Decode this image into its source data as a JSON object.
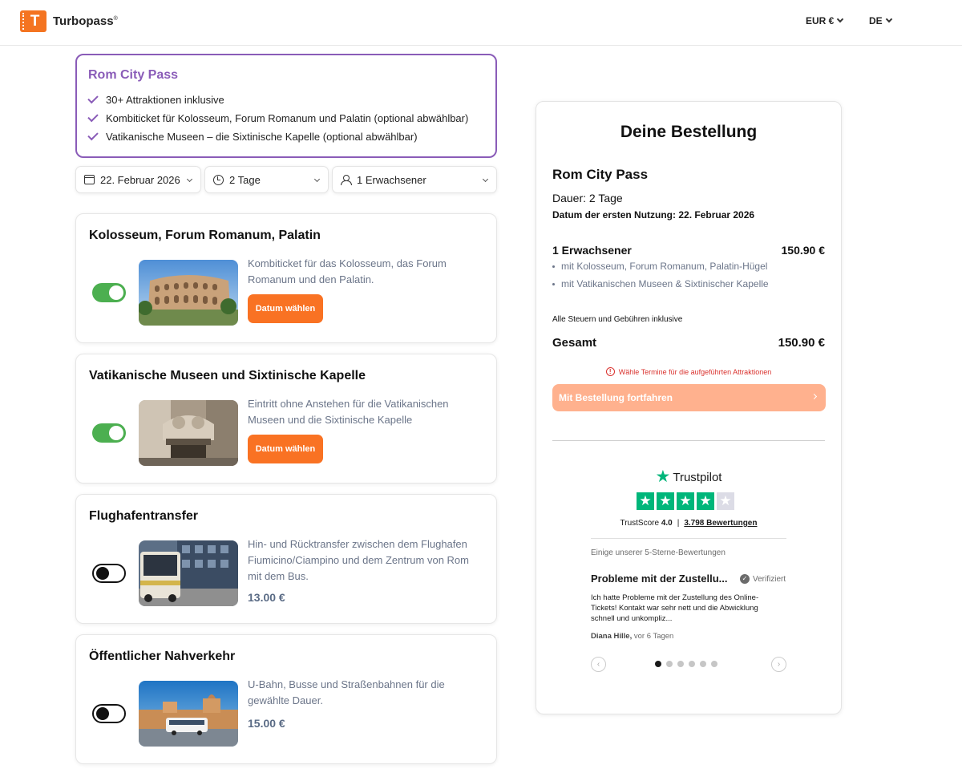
{
  "header": {
    "logo_letter": "T",
    "logo_text": "Turbopass",
    "logo_reg": "®",
    "currency": "EUR €",
    "language": "DE"
  },
  "pass": {
    "title": "Rom City Pass",
    "features": [
      "30+ Attraktionen inklusive",
      "Kombiticket für Kolosseum, Forum Romanum und Palatin (optional abwählbar)",
      "Vatikanische Museen – die Sixtinische Kapelle (optional abwählbar)"
    ]
  },
  "selectors": {
    "date": "22. Februar 2026",
    "duration": "2 Tage",
    "travelers": "1 Erwachsener"
  },
  "attractions": [
    {
      "title": "Kolosseum, Forum Romanum, Palatin",
      "description": "Kombiticket für das Kolosseum, das Forum Romanum und den Palatin.",
      "enabled": true,
      "button": "Datum wählen",
      "price": ""
    },
    {
      "title": "Vatikanische Museen und Sixtinische Kapelle",
      "description": "Eintritt ohne Anstehen für die Vatikanischen Museen und die Sixtinische Kapelle",
      "enabled": true,
      "button": "Datum wählen",
      "price": ""
    },
    {
      "title": "Flughafentransfer",
      "description": "Hin- und Rücktransfer zwischen dem Flughafen Fiumicino/Ciampino und dem Zentrum von Rom mit dem Bus.",
      "enabled": false,
      "button": "",
      "price": "13.00 €"
    },
    {
      "title": "Öffentlicher Nahverkehr",
      "description": "U-Bahn, Busse und Straßenbahnen für die gewählte Dauer.",
      "enabled": false,
      "button": "",
      "price": "15.00 €"
    }
  ],
  "order": {
    "title": "Deine Bestellung",
    "pass_name": "Rom City Pass",
    "duration": "Dauer: 2 Tage",
    "first_use": "Datum der ersten Nutzung: 22. Februar 2026",
    "line_label": "1 Erwachsener",
    "line_price": "150.90 €",
    "bullets": [
      "mit Kolosseum, Forum Romanum, Palatin-Hügel",
      "mit Vatikanischen Museen & Sixtinischer Kapelle"
    ],
    "tax_note": "Alle Steuern und Gebühren inklusive",
    "total_label": "Gesamt",
    "total_price": "150.90 €",
    "warning": "Wähle Termine für die aufgeführten Attraktionen",
    "continue_label": "Mit Bestellung fortfahren",
    "colors": {
      "accent": "#f97223",
      "disabled_button": "#ffb18e",
      "warning": "#d9302c"
    }
  },
  "trustpilot": {
    "brand": "Trustpilot",
    "rating_stars": 4,
    "trustscore_label": "TrustScore",
    "trustscore_value": "4.0",
    "review_count": "3.798 Bewertungen",
    "subtitle": "Einige unserer 5-Sterne-Bewertungen",
    "review_title": "Probleme mit der Zustellu...",
    "verified": "Verifiziert",
    "review_body": "Ich hatte Probleme mit der Zustellung des Online-Tickets! Kontakt war sehr nett und die Abwicklung schnell und unkompliz...",
    "author": "Diana Hille,",
    "author_time": "vor 6 Tagen",
    "slides": 6,
    "active_slide": 0
  }
}
